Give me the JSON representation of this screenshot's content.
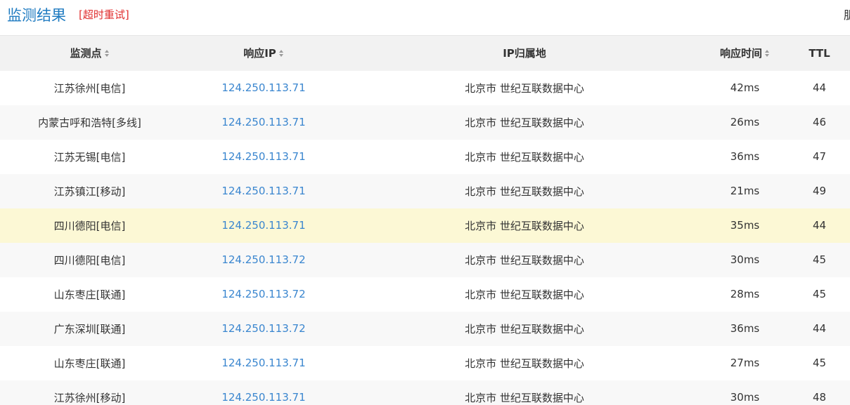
{
  "header": {
    "title": "监测结果",
    "retry_label": "[超时重试]",
    "right_partial": "肌"
  },
  "table": {
    "columns": [
      {
        "label": "监测点",
        "sortable": true
      },
      {
        "label": "响应IP",
        "sortable": true
      },
      {
        "label": "IP归属地",
        "sortable": false
      },
      {
        "label": "响应时间",
        "sortable": true
      },
      {
        "label": "TTL",
        "sortable": false
      }
    ],
    "rows": [
      {
        "point": "江苏徐州[电信]",
        "ip": "124.250.113.71",
        "location": "北京市 世纪互联数据中心",
        "time": "42ms",
        "ttl": "44",
        "highlight": false
      },
      {
        "point": "内蒙古呼和浩特[多线]",
        "ip": "124.250.113.71",
        "location": "北京市 世纪互联数据中心",
        "time": "26ms",
        "ttl": "46",
        "highlight": false
      },
      {
        "point": "江苏无锡[电信]",
        "ip": "124.250.113.71",
        "location": "北京市 世纪互联数据中心",
        "time": "36ms",
        "ttl": "47",
        "highlight": false
      },
      {
        "point": "江苏镇江[移动]",
        "ip": "124.250.113.71",
        "location": "北京市 世纪互联数据中心",
        "time": "21ms",
        "ttl": "49",
        "highlight": false
      },
      {
        "point": "四川德阳[电信]",
        "ip": "124.250.113.71",
        "location": "北京市 世纪互联数据中心",
        "time": "35ms",
        "ttl": "44",
        "highlight": true
      },
      {
        "point": "四川德阳[电信]",
        "ip": "124.250.113.72",
        "location": "北京市 世纪互联数据中心",
        "time": "30ms",
        "ttl": "45",
        "highlight": false
      },
      {
        "point": "山东枣庄[联通]",
        "ip": "124.250.113.72",
        "location": "北京市 世纪互联数据中心",
        "time": "28ms",
        "ttl": "45",
        "highlight": false
      },
      {
        "point": "广东深圳[联通]",
        "ip": "124.250.113.72",
        "location": "北京市 世纪互联数据中心",
        "time": "36ms",
        "ttl": "44",
        "highlight": false
      },
      {
        "point": "山东枣庄[联通]",
        "ip": "124.250.113.71",
        "location": "北京市 世纪互联数据中心",
        "time": "27ms",
        "ttl": "45",
        "highlight": false
      },
      {
        "point": "江苏徐州[移动]",
        "ip": "124.250.113.71",
        "location": "北京市 世纪互联数据中心",
        "time": "30ms",
        "ttl": "48",
        "highlight": false
      }
    ]
  },
  "colors": {
    "title": "#1f7bc1",
    "retry": "#e03030",
    "ip_link": "#3a86cf",
    "header_bg": "#f2f2f2",
    "row_alt_bg": "#f8f8f8",
    "row_highlight_bg": "#fcf8d5"
  },
  "icons": {
    "sort": "sort-icon"
  }
}
